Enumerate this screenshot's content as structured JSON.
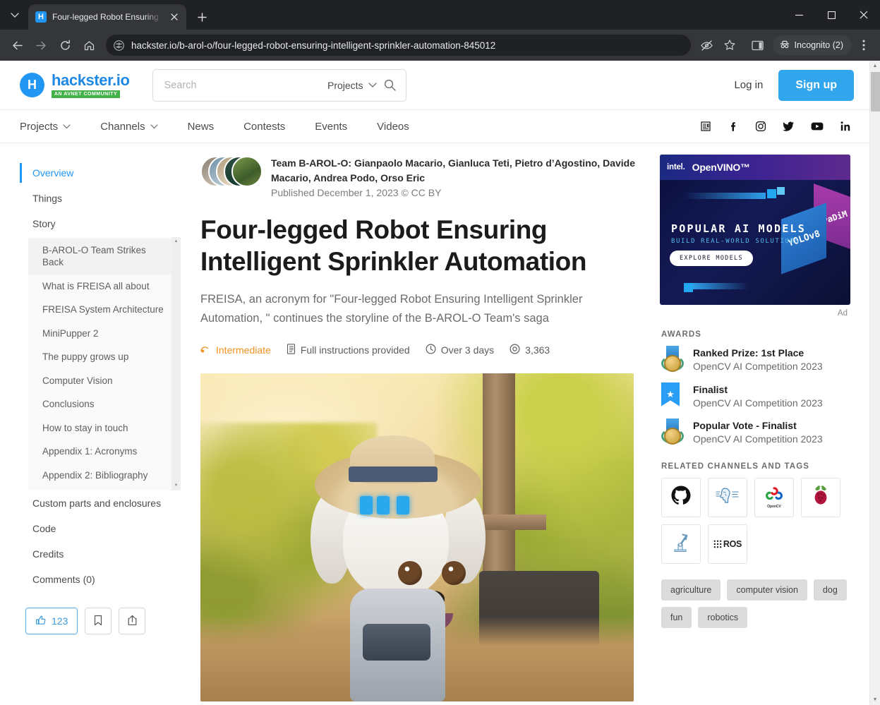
{
  "browser": {
    "tab": {
      "title": "Four-legged Robot Ensuring Int",
      "favicon_label": "H",
      "close_icon": "close-icon"
    },
    "new_tab_label": "+",
    "window": {
      "minimize": "–",
      "maximize": "▢",
      "close": "✕"
    },
    "toolbar": {
      "back": "back-arrow-icon",
      "forward": "forward-arrow-icon",
      "reload": "reload-icon",
      "home": "home-icon",
      "site_info": "site-settings-icon",
      "url": "hackster.io/b-arol-o/four-legged-robot-ensuring-intelligent-sprinkler-automation-845012",
      "tracking_protection": "eye-slash-icon",
      "bookmark": "star-icon",
      "side_panel": "side-panel-icon",
      "profile_label": "Incognito (2)",
      "menu": "three-dot-menu-icon"
    }
  },
  "site": {
    "brand": {
      "mark": "H",
      "name": "hackster.io",
      "tagline": "AN AVNET COMMUNITY"
    },
    "search": {
      "placeholder": "Search",
      "value": "",
      "scope": "Projects"
    },
    "header_links": {
      "login": "Log in",
      "signup": "Sign up"
    },
    "nav": [
      {
        "label": "Projects",
        "caret": true
      },
      {
        "label": "Channels",
        "caret": true
      },
      {
        "label": "News",
        "caret": false
      },
      {
        "label": "Contests",
        "caret": false
      },
      {
        "label": "Events",
        "caret": false
      },
      {
        "label": "Videos",
        "caret": false
      }
    ],
    "social": [
      {
        "name": "news-icon",
        "glyph": "📰"
      },
      {
        "name": "facebook-icon",
        "glyph": "f"
      },
      {
        "name": "instagram-icon",
        "glyph": "▢"
      },
      {
        "name": "twitter-icon",
        "glyph": "🐦"
      },
      {
        "name": "youtube-icon",
        "glyph": "▶"
      },
      {
        "name": "linkedin-icon",
        "glyph": "in"
      }
    ]
  },
  "toc": {
    "items": [
      {
        "label": "Overview",
        "active": true
      },
      {
        "label": "Things",
        "active": false
      },
      {
        "label": "Story",
        "active": false
      }
    ],
    "story_sections": [
      {
        "label": "B-AROL-O Team Strikes Back",
        "highlight": true
      },
      {
        "label": "What is FREISA all about",
        "highlight": false
      },
      {
        "label": "FREISA System Architecture",
        "highlight": false
      },
      {
        "label": "MiniPupper 2",
        "highlight": false
      },
      {
        "label": "The puppy grows up",
        "highlight": false
      },
      {
        "label": "Computer Vision",
        "highlight": false
      },
      {
        "label": "Conclusions",
        "highlight": false
      },
      {
        "label": "How to stay in touch",
        "highlight": false
      },
      {
        "label": "Appendix 1: Acronyms",
        "highlight": false
      },
      {
        "label": "Appendix 2: Bibliography",
        "highlight": false
      }
    ],
    "tail_items": [
      {
        "label": "Custom parts and enclosures"
      },
      {
        "label": "Code"
      },
      {
        "label": "Credits"
      },
      {
        "label": "Comments (0)"
      }
    ]
  },
  "actions": {
    "like_count": "123",
    "like_icon": "thumbs-up-icon",
    "bookmark_icon": "bookmark-icon",
    "share_icon": "share-icon"
  },
  "article": {
    "authors": "Team B-AROL-O: Gianpaolo Macario, Gianluca Teti, Pietro d’Agostino, Davide Macario, Andrea Podo, Orso Eric",
    "published": "Published December 1, 2023 © CC BY",
    "title": "Four-legged Robot Ensuring Intelligent Sprinkler Automation",
    "subtitle": "FREISA, an acronym for \"Four-legged Robot Ensuring Intelligent Sprinkler Automation, \" continues the storyline of the B-AROL-O Team's saga",
    "meta": [
      {
        "icon": "difficulty-icon",
        "label": "Intermediate"
      },
      {
        "icon": "document-icon",
        "label": "Full instructions provided"
      },
      {
        "icon": "clock-icon",
        "label": "Over 3 days"
      },
      {
        "icon": "eye-icon",
        "label": "3,363"
      }
    ]
  },
  "rail": {
    "ad": {
      "brand": "intel.",
      "product": "OpenVINO™",
      "headline": "POPULAR AI MODELS",
      "subhead": "BUILD REAL-WORLD SOLUTIONS",
      "cta": "EXPLORE MODELS",
      "cube_a": "YOLOv8",
      "cube_b": "PaDiM",
      "label": "Ad"
    },
    "awards_heading": "AWARDS",
    "awards": [
      {
        "icon": "gold-medal-icon",
        "title": "Ranked Prize: 1st Place",
        "subtitle": "OpenCV AI Competition 2023"
      },
      {
        "icon": "finalist-flag-icon",
        "title": "Finalist",
        "subtitle": "OpenCV AI Competition 2023"
      },
      {
        "icon": "gold-medal-icon",
        "title": "Popular Vote - Finalist",
        "subtitle": "OpenCV AI Competition 2023"
      }
    ],
    "channels_heading": "RELATED CHANNELS AND TAGS",
    "channels": [
      {
        "name": "github-icon",
        "glyph": "●",
        "label": ""
      },
      {
        "name": "ai-brain-icon",
        "glyph": "⌘",
        "label": ""
      },
      {
        "name": "opencv-icon",
        "glyph": "◔",
        "label": "OpenCV"
      },
      {
        "name": "raspberry-pi-icon",
        "glyph": "✿",
        "label": ""
      },
      {
        "name": "robot-arm-icon",
        "glyph": "⚙",
        "label": ""
      },
      {
        "name": "ros-icon",
        "glyph": "",
        "label": "ROS"
      }
    ],
    "tags": [
      "agriculture",
      "computer vision",
      "dog",
      "fun",
      "robotics"
    ]
  }
}
